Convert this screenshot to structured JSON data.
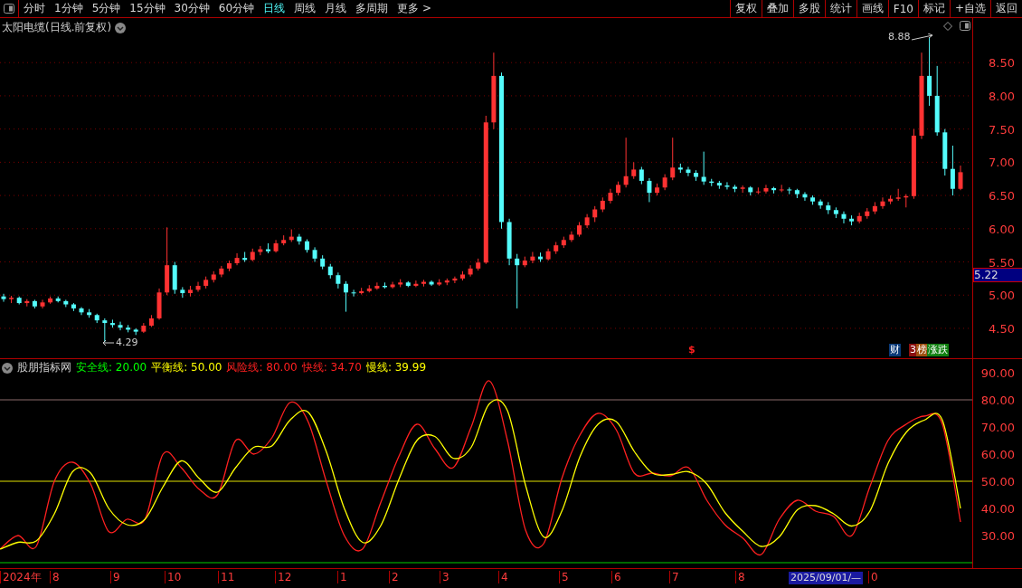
{
  "toolbar": {
    "periods": [
      {
        "label": "分时",
        "selected": false
      },
      {
        "label": "1分钟",
        "selected": false
      },
      {
        "label": "5分钟",
        "selected": false
      },
      {
        "label": "15分钟",
        "selected": false
      },
      {
        "label": "30分钟",
        "selected": false
      },
      {
        "label": "60分钟",
        "selected": false
      },
      {
        "label": "日线",
        "selected": true
      },
      {
        "label": "周线",
        "selected": false
      },
      {
        "label": "月线",
        "selected": false
      },
      {
        "label": "多周期",
        "selected": false
      },
      {
        "label": "更多 >",
        "selected": false
      }
    ],
    "actions": [
      "复权",
      "叠加",
      "多股",
      "统计",
      "画线",
      "F10",
      "标记",
      "+自选",
      "返回"
    ]
  },
  "price_panel": {
    "title": "太阳电缆(日线.前复权)",
    "current_price": "5.22",
    "high_mark": "8.88",
    "low_mark": "4.29",
    "chart_data": {
      "type": "candlestick",
      "ylim": [
        4.05,
        9.17
      ],
      "yticks": [
        {
          "value": 8.5,
          "label": "8.50"
        },
        {
          "value": 8,
          "label": "8.00"
        },
        {
          "value": 7.5,
          "label": "7.50"
        },
        {
          "value": 7,
          "label": "7.00"
        },
        {
          "value": 6.5,
          "label": "6.50"
        },
        {
          "value": 6,
          "label": "6.00"
        },
        {
          "value": 5.5,
          "label": "5.50"
        },
        {
          "value": 5,
          "label": "5.00"
        },
        {
          "value": 4.5,
          "label": "4.50"
        }
      ],
      "grid": true,
      "ohlc": [
        [
          4.98,
          5.02,
          4.9,
          4.94
        ],
        [
          4.94,
          4.99,
          4.88,
          4.96
        ],
        [
          4.96,
          4.98,
          4.86,
          4.88
        ],
        [
          4.88,
          4.94,
          4.83,
          4.91
        ],
        [
          4.91,
          4.93,
          4.8,
          4.83
        ],
        [
          4.83,
          4.93,
          4.8,
          4.89
        ],
        [
          4.89,
          4.98,
          4.87,
          4.95
        ],
        [
          4.95,
          4.98,
          4.89,
          4.91
        ],
        [
          4.91,
          4.93,
          4.82,
          4.86
        ],
        [
          4.86,
          4.88,
          4.76,
          4.8
        ],
        [
          4.8,
          4.82,
          4.7,
          4.74
        ],
        [
          4.74,
          4.79,
          4.66,
          4.7
        ],
        [
          4.7,
          4.72,
          4.58,
          4.62
        ],
        [
          4.62,
          4.65,
          4.29,
          4.58
        ],
        [
          4.58,
          4.63,
          4.51,
          4.55
        ],
        [
          4.55,
          4.6,
          4.47,
          4.51
        ],
        [
          4.51,
          4.55,
          4.44,
          4.48
        ],
        [
          4.48,
          4.5,
          4.4,
          4.45
        ],
        [
          4.45,
          4.58,
          4.43,
          4.54
        ],
        [
          4.54,
          4.7,
          4.52,
          4.65
        ],
        [
          4.65,
          5.1,
          4.63,
          5.04
        ],
        [
          5.04,
          6.02,
          5.0,
          5.45
        ],
        [
          5.45,
          5.5,
          5.02,
          5.08
        ],
        [
          5.08,
          5.12,
          4.96,
          5.03
        ],
        [
          5.03,
          5.14,
          4.98,
          5.08
        ],
        [
          5.08,
          5.2,
          5.05,
          5.14
        ],
        [
          5.14,
          5.28,
          5.1,
          5.23
        ],
        [
          5.23,
          5.36,
          5.19,
          5.31
        ],
        [
          5.31,
          5.44,
          5.27,
          5.4
        ],
        [
          5.4,
          5.52,
          5.36,
          5.48
        ],
        [
          5.48,
          5.63,
          5.45,
          5.56
        ],
        [
          5.56,
          5.65,
          5.5,
          5.53
        ],
        [
          5.53,
          5.7,
          5.51,
          5.65
        ],
        [
          5.65,
          5.74,
          5.6,
          5.69
        ],
        [
          5.69,
          5.78,
          5.63,
          5.66
        ],
        [
          5.66,
          5.83,
          5.64,
          5.78
        ],
        [
          5.78,
          5.9,
          5.75,
          5.83
        ],
        [
          5.83,
          5.99,
          5.8,
          5.88
        ],
        [
          5.88,
          5.92,
          5.76,
          5.81
        ],
        [
          5.81,
          5.84,
          5.64,
          5.68
        ],
        [
          5.68,
          5.72,
          5.5,
          5.55
        ],
        [
          5.55,
          5.6,
          5.39,
          5.43
        ],
        [
          5.43,
          5.47,
          5.25,
          5.3
        ],
        [
          5.3,
          5.34,
          5.1,
          5.17
        ],
        [
          5.17,
          5.21,
          4.75,
          5.04
        ],
        [
          5.04,
          5.08,
          4.98,
          5.03
        ],
        [
          5.03,
          5.11,
          5.01,
          5.06
        ],
        [
          5.06,
          5.15,
          5.04,
          5.1
        ],
        [
          5.1,
          5.19,
          5.08,
          5.14
        ],
        [
          5.14,
          5.19,
          5.1,
          5.12
        ],
        [
          5.12,
          5.2,
          5.1,
          5.16
        ],
        [
          5.16,
          5.24,
          5.12,
          5.19
        ],
        [
          5.19,
          5.21,
          5.12,
          5.14
        ],
        [
          5.14,
          5.22,
          5.12,
          5.17
        ],
        [
          5.17,
          5.23,
          5.13,
          5.2
        ],
        [
          5.2,
          5.22,
          5.14,
          5.16
        ],
        [
          5.16,
          5.24,
          5.14,
          5.19
        ],
        [
          5.19,
          5.25,
          5.15,
          5.22
        ],
        [
          5.22,
          5.28,
          5.18,
          5.25
        ],
        [
          5.25,
          5.36,
          5.22,
          5.31
        ],
        [
          5.31,
          5.45,
          5.28,
          5.4
        ],
        [
          5.4,
          5.55,
          5.37,
          5.49
        ],
        [
          5.49,
          7.7,
          5.47,
          7.6
        ],
        [
          7.6,
          8.65,
          7.5,
          8.3
        ],
        [
          8.3,
          8.35,
          6.0,
          6.1
        ],
        [
          6.1,
          6.15,
          5.45,
          5.55
        ],
        [
          5.55,
          5.62,
          4.8,
          5.45
        ],
        [
          5.45,
          5.58,
          5.42,
          5.52
        ],
        [
          5.52,
          5.65,
          5.48,
          5.58
        ],
        [
          5.58,
          5.64,
          5.5,
          5.54
        ],
        [
          5.54,
          5.7,
          5.52,
          5.66
        ],
        [
          5.66,
          5.8,
          5.62,
          5.75
        ],
        [
          5.75,
          5.88,
          5.71,
          5.83
        ],
        [
          5.83,
          5.96,
          5.8,
          5.91
        ],
        [
          5.91,
          6.1,
          5.88,
          6.05
        ],
        [
          6.05,
          6.22,
          6.01,
          6.17
        ],
        [
          6.17,
          6.34,
          6.1,
          6.29
        ],
        [
          6.29,
          6.47,
          6.25,
          6.42
        ],
        [
          6.42,
          6.6,
          6.38,
          6.54
        ],
        [
          6.54,
          6.71,
          6.5,
          6.66
        ],
        [
          6.66,
          7.37,
          6.62,
          6.79
        ],
        [
          6.79,
          7.0,
          6.75,
          6.89
        ],
        [
          6.89,
          6.93,
          6.67,
          6.72
        ],
        [
          6.72,
          6.76,
          6.4,
          6.54
        ],
        [
          6.54,
          6.68,
          6.5,
          6.62
        ],
        [
          6.62,
          6.82,
          6.58,
          6.77
        ],
        [
          6.77,
          7.37,
          6.73,
          6.92
        ],
        [
          6.92,
          6.98,
          6.84,
          6.89
        ],
        [
          6.89,
          6.93,
          6.79,
          6.84
        ],
        [
          6.84,
          6.88,
          6.72,
          6.78
        ],
        [
          6.78,
          7.16,
          6.66,
          6.71
        ],
        [
          6.71,
          6.75,
          6.64,
          6.69
        ],
        [
          6.69,
          6.72,
          6.6,
          6.65
        ],
        [
          6.65,
          6.7,
          6.59,
          6.63
        ],
        [
          6.63,
          6.66,
          6.55,
          6.6
        ],
        [
          6.6,
          6.65,
          6.54,
          6.62
        ],
        [
          6.62,
          6.64,
          6.5,
          6.55
        ],
        [
          6.55,
          6.62,
          6.52,
          6.56
        ],
        [
          6.56,
          6.66,
          6.53,
          6.61
        ],
        [
          6.61,
          6.63,
          6.53,
          6.58
        ],
        [
          6.58,
          6.66,
          6.55,
          6.59
        ],
        [
          6.59,
          6.62,
          6.52,
          6.58
        ],
        [
          6.58,
          6.6,
          6.46,
          6.52
        ],
        [
          6.52,
          6.55,
          6.42,
          6.47
        ],
        [
          6.47,
          6.5,
          6.36,
          6.41
        ],
        [
          6.41,
          6.44,
          6.3,
          6.35
        ],
        [
          6.35,
          6.4,
          6.22,
          6.28
        ],
        [
          6.28,
          6.32,
          6.16,
          6.22
        ],
        [
          6.22,
          6.26,
          6.08,
          6.15
        ],
        [
          6.15,
          6.2,
          6.05,
          6.11
        ],
        [
          6.11,
          6.24,
          6.08,
          6.19
        ],
        [
          6.19,
          6.31,
          6.15,
          6.26
        ],
        [
          6.26,
          6.4,
          6.22,
          6.34
        ],
        [
          6.34,
          6.47,
          6.3,
          6.41
        ],
        [
          6.41,
          6.5,
          6.37,
          6.45
        ],
        [
          6.45,
          6.6,
          6.42,
          6.47
        ],
        [
          6.47,
          6.52,
          6.32,
          6.49
        ],
        [
          6.49,
          7.5,
          6.45,
          7.4
        ],
        [
          7.4,
          8.65,
          7.35,
          8.3
        ],
        [
          8.3,
          8.88,
          7.85,
          8.0
        ],
        [
          8.0,
          8.45,
          7.4,
          7.45
        ],
        [
          7.45,
          7.5,
          6.8,
          6.9
        ],
        [
          6.9,
          7.25,
          6.5,
          6.6
        ],
        [
          6.6,
          6.95,
          6.58,
          6.85
        ]
      ]
    },
    "event_marks": [
      {
        "text": "$",
        "color": "#ff2020"
      },
      {
        "text": "财",
        "color": "#0a3a78"
      },
      {
        "text": "3",
        "color": "#8b1010"
      },
      {
        "text": "榜",
        "color": "#a05010"
      },
      {
        "text": "涨跌",
        "color": "#108010"
      }
    ]
  },
  "indicator_panel": {
    "name": "股朋指标网",
    "legend": [
      {
        "label": "安全线: 20.00",
        "color": "#00ff00"
      },
      {
        "label": "平衡线: 50.00",
        "color": "#ffff00"
      },
      {
        "label": "风险线: 80.00",
        "color": "#ff2020"
      },
      {
        "label": "快线: 34.70",
        "color": "#ff2020"
      },
      {
        "label": "慢线: 39.99",
        "color": "#ffff00"
      }
    ],
    "chart_data": {
      "type": "line",
      "ylim": [
        18,
        95
      ],
      "ref_lines": [
        {
          "axis": "y",
          "value": 80,
          "color": "#8a6a6a"
        },
        {
          "axis": "y",
          "value": 50,
          "color": "#e0e000"
        },
        {
          "axis": "y",
          "value": 20,
          "color": "#00d000"
        }
      ],
      "yticks": [
        {
          "value": 90,
          "label": "90.00"
        },
        {
          "value": 80,
          "label": "80.00"
        },
        {
          "value": 70,
          "label": "70.00"
        },
        {
          "value": 60,
          "label": "60.00"
        },
        {
          "value": 50,
          "label": "50.00"
        },
        {
          "value": 40,
          "label": "40.00"
        },
        {
          "value": 30,
          "label": "30.00"
        }
      ],
      "series": [
        {
          "color": "#ff2020",
          "values": [
            25,
            30,
            26,
            50,
            57,
            49,
            31.5,
            36,
            36,
            60,
            55,
            47,
            45,
            65,
            60,
            66,
            79,
            72,
            50,
            30,
            25,
            42,
            59,
            71,
            62,
            55,
            70,
            87,
            65,
            32,
            27,
            51,
            67,
            75,
            69,
            53,
            53,
            52,
            55,
            43,
            34,
            29,
            23,
            36,
            43,
            39,
            37,
            30,
            48,
            65,
            71,
            74,
            71,
            35
          ]
        },
        {
          "color": "#ffff00",
          "values": [
            25,
            27.5,
            28,
            38,
            53.5,
            53,
            40,
            34,
            36,
            48,
            57.5,
            51,
            46,
            55,
            62.5,
            63,
            72.5,
            75.5,
            61,
            40,
            27.5,
            33.5,
            50.5,
            65,
            66.5,
            58.5,
            62.5,
            78.5,
            76,
            48.5,
            29.5,
            39,
            59,
            71,
            72,
            61,
            53,
            52.5,
            53.5,
            49,
            38.5,
            31.5,
            26,
            29.5,
            39.5,
            41,
            38,
            33.5,
            39,
            56.5,
            68,
            72.5,
            72.5,
            40
          ]
        }
      ]
    }
  },
  "time_axis": {
    "labels": [
      "2024年",
      "8",
      "9",
      "10",
      "11",
      "12",
      "1",
      "2",
      "3",
      "4",
      "5",
      "6",
      "7",
      "8"
    ],
    "cursor_date": "2025/09/01/—",
    "cursor_tail": "0"
  }
}
